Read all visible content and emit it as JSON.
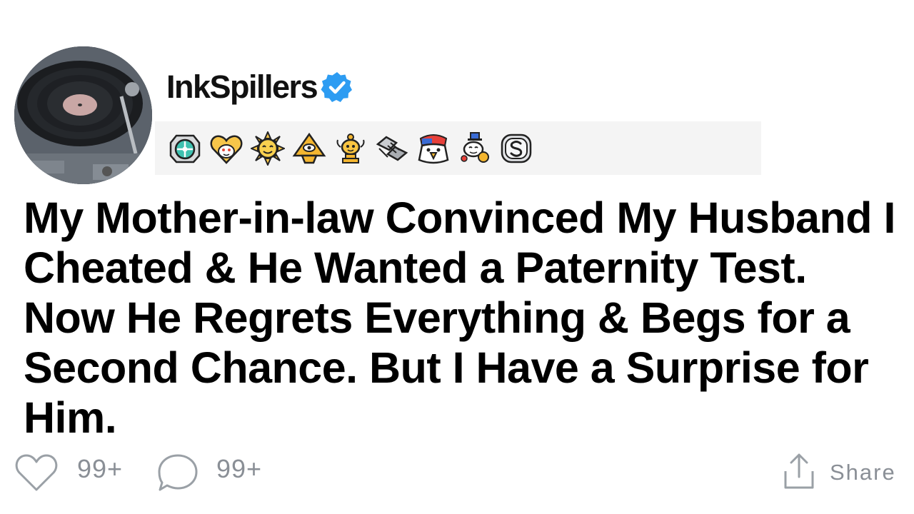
{
  "author": {
    "username": "InkSpillers",
    "verified": true,
    "avatar": "turntable-record-avatar"
  },
  "awards": [
    {
      "icon": "compass-badge-award-icon"
    },
    {
      "icon": "heart-snoo-award-icon"
    },
    {
      "icon": "sun-face-award-icon"
    },
    {
      "icon": "pyramid-eye-award-icon"
    },
    {
      "icon": "gold-trophy-snoo-award-icon"
    },
    {
      "icon": "handshake-award-icon"
    },
    {
      "icon": "eagle-award-icon"
    },
    {
      "icon": "snoo-party-award-icon"
    },
    {
      "icon": "silver-coin-award-icon"
    }
  ],
  "post": {
    "title": "My Mother-in-law Convinced My Husband I Cheated & He Wanted a Paternity Test. Now He Regrets Everything & Begs for a Second Chance. But I Have a Surprise for Him."
  },
  "actions": {
    "likes_count": "99+",
    "comments_count": "99+",
    "share_label": "Share"
  },
  "colors": {
    "verified": "#2d9cf2",
    "muted_text": "#8a8f96",
    "awards_bg": "#f4f4f4"
  }
}
